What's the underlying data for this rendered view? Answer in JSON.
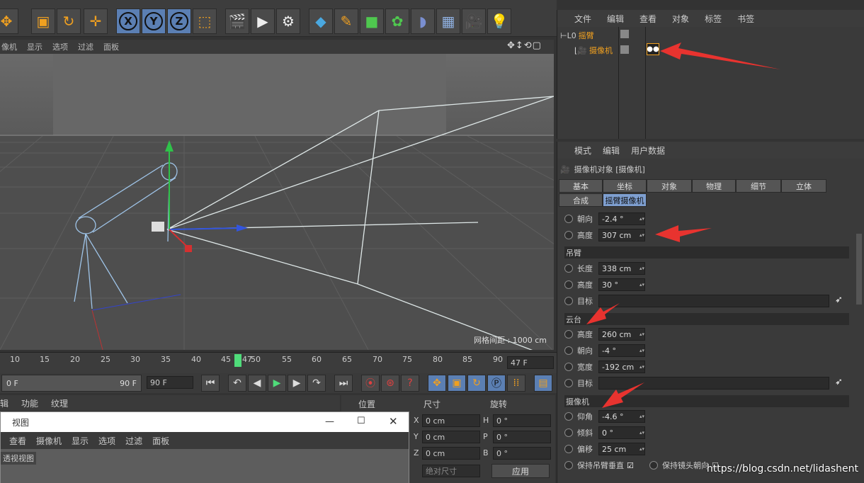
{
  "toolbar": {
    "icons": [
      "move-icon",
      "scale-icon",
      "rotate-icon",
      "move-alt-icon",
      "x-axis-icon",
      "y-axis-icon",
      "z-axis-icon",
      "coord-system-icon",
      "render-view-icon",
      "render-icon",
      "render-settings-icon",
      "cube-icon",
      "pen-icon",
      "subdivision-icon",
      "mograph-icon",
      "deformer-icon",
      "floor-icon",
      "camera-icon",
      "light-icon"
    ],
    "x": "X",
    "y": "Y",
    "z": "Z"
  },
  "viewport": {
    "menu": [
      "像机",
      "显示",
      "选项",
      "过滤",
      "面板"
    ],
    "grid_label": "网格间距 : 1000 cm"
  },
  "timeline": {
    "ticks": [
      "10",
      "15",
      "20",
      "25",
      "30",
      "35",
      "40",
      "45",
      "47",
      "50",
      "55",
      "60",
      "65",
      "70",
      "75",
      "80",
      "85",
      "90"
    ],
    "current_frame": "47 F",
    "start": "0 F",
    "end": "90 F",
    "end_field": "90 F"
  },
  "lower": {
    "tabs": [
      "辑",
      "功能",
      "纹理"
    ]
  },
  "subwindow": {
    "title": "视图",
    "menu": [
      "查看",
      "摄像机",
      "显示",
      "选项",
      "过滤",
      "面板"
    ],
    "view_label": "透视视图"
  },
  "coords": {
    "headers": [
      "位置",
      "尺寸",
      "旋转"
    ],
    "rows": [
      {
        "axis": "X",
        "pos": "0 cm",
        "rot_axis": "H",
        "rot": "0 °"
      },
      {
        "axis": "Y",
        "pos": "0 cm",
        "rot_axis": "P",
        "rot": "0 °"
      },
      {
        "axis": "Z",
        "pos": "0 cm",
        "rot_axis": "B",
        "rot": "0 °"
      }
    ],
    "mode": "绝对尺寸",
    "apply": "应用"
  },
  "objmgr": {
    "menu": [
      "文件",
      "编辑",
      "查看",
      "对象",
      "标签",
      "书签"
    ],
    "items": [
      {
        "name": "摇臂"
      },
      {
        "name": "摄像机"
      }
    ]
  },
  "attr": {
    "menu": [
      "模式",
      "编辑",
      "用户数据"
    ],
    "title": "摄像机对象 [摄像机]",
    "tabs_row1": [
      "基本",
      "坐标",
      "对象",
      "物理",
      "细节",
      "立体"
    ],
    "tabs_row2": [
      "合成",
      "摇臂摄像机"
    ],
    "base": [
      {
        "label": "朝向",
        "value": "-2.4 °"
      },
      {
        "label": "高度",
        "value": "307 cm"
      }
    ],
    "boom_title": "吊臂",
    "boom": [
      {
        "label": "长度",
        "value": "338 cm"
      },
      {
        "label": "高度",
        "value": "30 °"
      }
    ],
    "boom_target": "目标",
    "head_title": "云台",
    "head": [
      {
        "label": "高度",
        "value": "260 cm"
      },
      {
        "label": "朝向",
        "value": "-4 °"
      },
      {
        "label": "宽度",
        "value": "-192 cm"
      }
    ],
    "head_target": "目标",
    "cam_title": "摄像机",
    "cam": [
      {
        "label": "仰角",
        "value": "-4.6 °"
      },
      {
        "label": "倾斜",
        "value": "0 °"
      },
      {
        "label": "偏移",
        "value": "25 cm"
      }
    ],
    "keep_vertical": "保持吊臂垂直",
    "keep_dir": "保持镜头朝向"
  },
  "watermark": "https://blog.csdn.net/lidashent",
  "colors": {
    "accent": "#7e9fd0",
    "arrow": "#e8332f",
    "object_name": "#f0a020"
  }
}
